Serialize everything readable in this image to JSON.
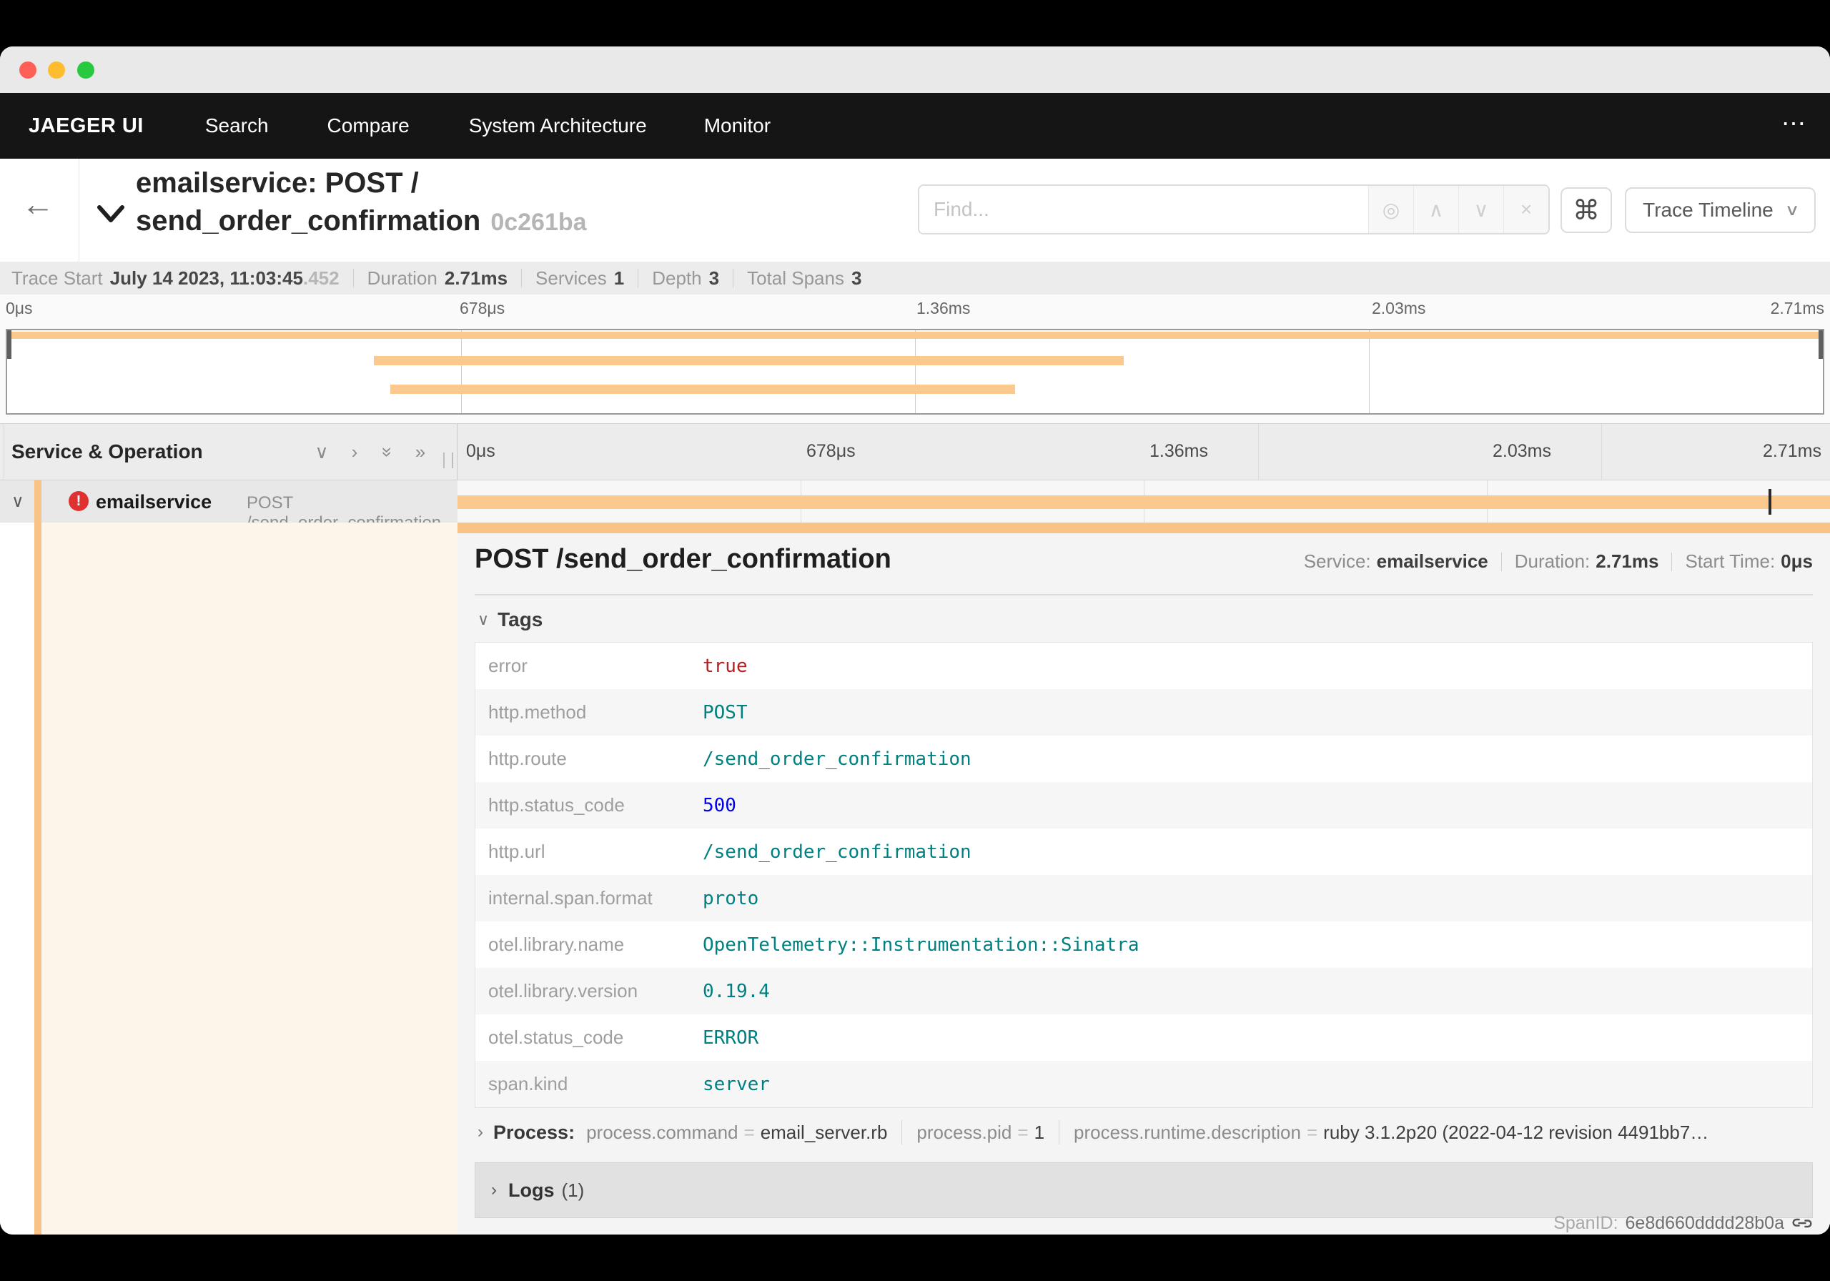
{
  "nav": {
    "brand": "JAEGER UI",
    "items": [
      "Search",
      "Compare",
      "System Architecture",
      "Monitor"
    ],
    "more": "⋯"
  },
  "trace_header": {
    "back_glyph": "←",
    "title_line1": "emailservice: POST /",
    "title_line2": "send_order_confirmation",
    "trace_id_short": "0c261ba",
    "find_placeholder": "Find...",
    "shortcut_glyph": "⌘",
    "view_selector_label": "Trace Timeline",
    "view_caret": "∨"
  },
  "find_icons": {
    "locate": "◎",
    "prev": "∧",
    "next": "∨",
    "clear": "×"
  },
  "stats": [
    {
      "label": "Trace Start",
      "value": "July 14 2023, 11:03:45",
      "muted": ".452"
    },
    {
      "label": "Duration",
      "value": "2.71ms"
    },
    {
      "label": "Services",
      "value": "1"
    },
    {
      "label": "Depth",
      "value": "3"
    },
    {
      "label": "Total Spans",
      "value": "3"
    }
  ],
  "minimap": {
    "ticks": [
      "0μs",
      "678μs",
      "1.36ms",
      "2.03ms",
      "2.71ms"
    ],
    "spans": [
      {
        "left": "0%",
        "width": "100%"
      },
      {
        "left": "20.2%",
        "width": "41.3%"
      },
      {
        "left": "21.1%",
        "width": "34.4%"
      }
    ]
  },
  "timeline": {
    "left_header": "Service & Operation",
    "header_icons": {
      "collapse_one": "∨",
      "expand_one": "›",
      "collapse_all": "»",
      "expand_all": "»"
    },
    "ticks": [
      "0μs",
      "678μs",
      "1.36ms",
      "2.03ms",
      "2.71ms"
    ],
    "row": {
      "chevron": "∨",
      "error_glyph": "!",
      "service": "emailservice",
      "operation": "POST /send_order_confirmation",
      "bar": {
        "left": "0%",
        "width": "100%"
      },
      "log_tick": {
        "left": "95.5%"
      }
    }
  },
  "detail": {
    "title": "POST /send_order_confirmation",
    "meta": [
      {
        "label": "Service:",
        "value": "emailservice"
      },
      {
        "label": "Duration:",
        "value": "2.71ms"
      },
      {
        "label": "Start Time:",
        "value": "0μs"
      }
    ],
    "tags_header": "Tags",
    "tags_chevron": "∨",
    "tags": [
      {
        "key": "error",
        "value": "true"
      },
      {
        "key": "http.method",
        "value": "POST"
      },
      {
        "key": "http.route",
        "value": "/send_order_confirmation"
      },
      {
        "key": "http.status_code",
        "value": "500"
      },
      {
        "key": "http.url",
        "value": "/send_order_confirmation"
      },
      {
        "key": "internal.span.format",
        "value": "proto"
      },
      {
        "key": "otel.library.name",
        "value": "OpenTelemetry::Instrumentation::Sinatra"
      },
      {
        "key": "otel.library.version",
        "value": "0.19.4"
      },
      {
        "key": "otel.status_code",
        "value": "ERROR"
      },
      {
        "key": "span.kind",
        "value": "server"
      }
    ],
    "process": {
      "chevron": "›",
      "label": "Process:",
      "eq": "=",
      "items": [
        {
          "key": "process.command",
          "value": "email_server.rb"
        },
        {
          "key": "process.pid",
          "value": "1"
        },
        {
          "key": "process.runtime.description",
          "value": "ruby 3.1.2p20 (2022-04-12 revision 4491bb7…"
        }
      ]
    },
    "logs": {
      "chevron": "›",
      "label": "Logs",
      "count": "(1)"
    },
    "span_id": {
      "label": "SpanID:",
      "value": "6e8d660dddd28b0a"
    }
  },
  "colors": {
    "accent_orange": "#fbc88e",
    "error_red": "#e03131",
    "tag_string": "#008080",
    "tag_number": "#0000e8",
    "tag_bool": "#b22222"
  }
}
